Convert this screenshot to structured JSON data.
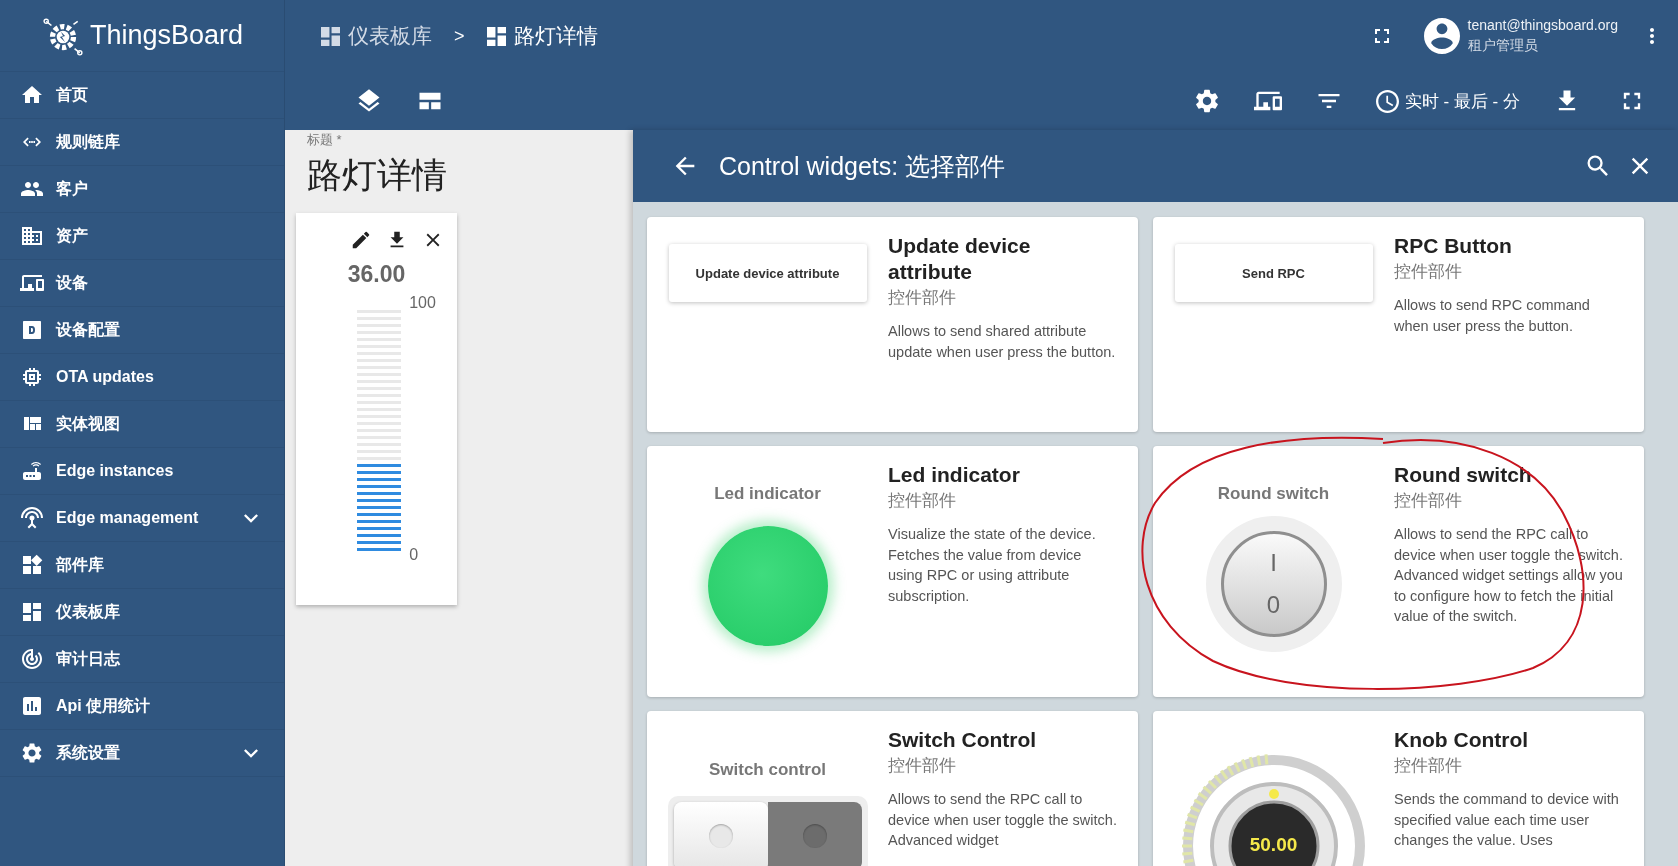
{
  "header": {
    "logo": "ThingsBoard",
    "breadcrumbs": [
      {
        "label": "仪表板库",
        "current": false
      },
      {
        "label": "路灯详情",
        "current": true
      }
    ],
    "separator": ">",
    "user": {
      "email": "tenant@thingsboard.org",
      "role": "租户管理员"
    }
  },
  "sidebar": {
    "items": [
      {
        "label": "首页",
        "expandable": false
      },
      {
        "label": "规则链库",
        "expandable": false
      },
      {
        "label": "客户",
        "expandable": false
      },
      {
        "label": "资产",
        "expandable": false
      },
      {
        "label": "设备",
        "expandable": false
      },
      {
        "label": "设备配置",
        "expandable": false
      },
      {
        "label": "OTA updates",
        "expandable": false
      },
      {
        "label": "实体视图",
        "expandable": false
      },
      {
        "label": "Edge instances",
        "expandable": false
      },
      {
        "label": "Edge management",
        "expandable": true
      },
      {
        "label": "部件库",
        "expandable": false
      },
      {
        "label": "仪表板库",
        "expandable": false
      },
      {
        "label": "审计日志",
        "expandable": false
      },
      {
        "label": "Api 使用统计",
        "expandable": false
      },
      {
        "label": "系统设置",
        "expandable": true
      }
    ]
  },
  "toolbar": {
    "timewindow": "实时 - 最后 - 分"
  },
  "dashboard": {
    "title_label": "标题 *",
    "title": "路灯详情",
    "widget": {
      "value": "36.00",
      "max": "100",
      "min": "0",
      "level": 0.36
    }
  },
  "panel": {
    "title": "Control widgets: 选择部件",
    "cards": [
      {
        "kind": "button",
        "preview_label": "Update device attribute",
        "title": "Update device attribute",
        "type": "控件部件",
        "description": "Allows to send shared attribute update when user press the button.",
        "annotated": false
      },
      {
        "kind": "button",
        "preview_label": "Send RPC",
        "title": "RPC Button",
        "type": "控件部件",
        "description": "Allows to send RPC command when user press the button.",
        "annotated": false
      },
      {
        "kind": "led",
        "preview_label": "Led indicator",
        "title": "Led indicator",
        "type": "控件部件",
        "description": "Visualize the state of the device. Fetches the value from device using RPC or using attribute subscription.",
        "annotated": false
      },
      {
        "kind": "round-switch",
        "preview_label": "Round switch",
        "on_mark": "I",
        "off_mark": "0",
        "on": false,
        "title": "Round switch",
        "type": "控件部件",
        "description": "Allows to send the RPC call to device when user toggle the switch. Advanced widget settings allow you to configure how to fetch the initial value of the switch.",
        "annotated": true
      },
      {
        "kind": "switch",
        "preview_label": "Switch control",
        "on": false,
        "title": "Switch Control",
        "type": "控件部件",
        "description": "Allows to send the RPC call to device when user toggle the switch. Advanced widget",
        "annotated": false
      },
      {
        "kind": "knob",
        "knob_value": "50.00",
        "title": "Knob Control",
        "type": "控件部件",
        "description": "Sends the command to device with specified value each time user changes the value. Uses",
        "annotated": false
      }
    ]
  }
}
